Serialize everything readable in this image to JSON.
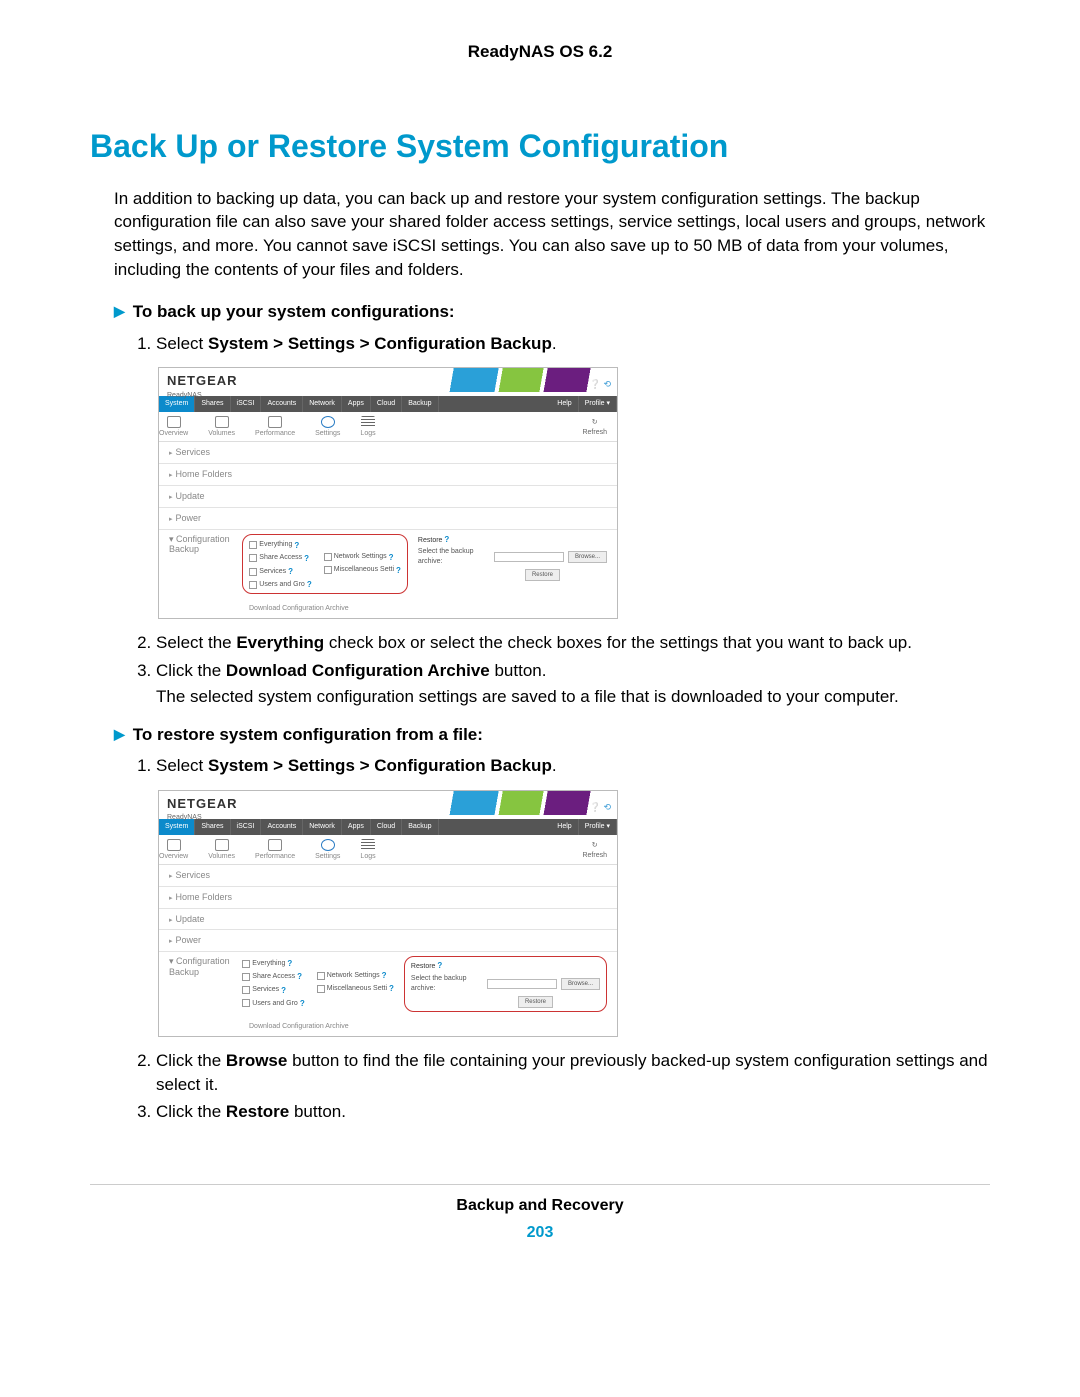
{
  "doc": {
    "header": "ReadyNAS OS 6.2",
    "footer_title": "Backup and Recovery",
    "page_number": "203"
  },
  "section": {
    "title": "Back Up or Restore System Configuration",
    "intro": "In addition to backing up data, you can back up and restore your system configuration settings. The backup configuration file can also save your shared folder access settings, service settings, local users and groups, network settings, and more. You cannot save iSCSI settings. You can also save up to 50 MB of data from your volumes, including the contents of your files and folders."
  },
  "proc1": {
    "heading": "To back up your system configurations:",
    "step1_prefix": "Select ",
    "step1_bold": "System > Settings > Configuration Backup",
    "step1_suffix": ".",
    "step2_prefix": "Select the ",
    "step2_bold": "Everything",
    "step2_suffix": " check box or select the check boxes for the settings that you want to back up.",
    "step3_prefix": "Click the ",
    "step3_bold": "Download Configuration Archive",
    "step3_suffix": " button.",
    "step3_body": "The selected system configuration settings are saved to a file that is downloaded to your computer."
  },
  "proc2": {
    "heading": "To restore system configuration from a file:",
    "step1_prefix": "Select ",
    "step1_bold": "System > Settings > Configuration Backup",
    "step1_suffix": ".",
    "step2_prefix": "Click the ",
    "step2_bold": "Browse",
    "step2_suffix": " button to find the file containing your previously backed-up system configuration settings and select it.",
    "step3_prefix": "Click the ",
    "step3_bold": "Restore",
    "step3_suffix": " button."
  },
  "ui": {
    "brand": "NETGEAR",
    "subbrand": "ReadyNAS",
    "nav": [
      "System",
      "Shares",
      "iSCSI",
      "Accounts",
      "Network",
      "Apps",
      "Cloud",
      "Backup"
    ],
    "nav_right": [
      "Help",
      "Profile ▾"
    ],
    "subnav": [
      "Overview",
      "Volumes",
      "Performance",
      "Settings",
      "Logs"
    ],
    "refresh": "Refresh",
    "sidebar": [
      "Services",
      "Home Folders",
      "Update",
      "Power"
    ],
    "config_label": "Configuration Backup",
    "checks_col1": [
      "Everything",
      "Share Access",
      "Services",
      "Users and Gro"
    ],
    "checks_col2": [
      "Network Settings",
      "Miscellaneous Setti"
    ],
    "restore_label": "Restore",
    "select_archive": "Select the backup archive:",
    "browse": "Browse...",
    "restore_btn": "Restore",
    "download": "Download Configuration Archive"
  }
}
